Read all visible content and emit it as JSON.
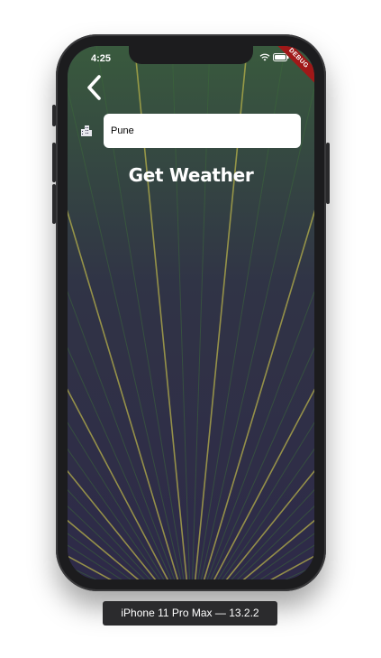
{
  "status_bar": {
    "time": "4:25",
    "wifi_icon": "wifi-icon",
    "battery_icon": "battery-icon"
  },
  "debug_banner": {
    "label": "DEBUG",
    "color": "#a01818"
  },
  "nav": {
    "back_icon": "chevron-left-icon"
  },
  "search": {
    "icon": "city-icon",
    "value": "Pune"
  },
  "action": {
    "label": "Get Weather"
  },
  "simulator": {
    "caption": "iPhone 11 Pro Max — 13.2.2"
  },
  "colors": {
    "background_dark": "#2e2a48",
    "leaf_green": "#3d6a3a",
    "leaf_yellow": "#b7b24a",
    "text": "#ffffff"
  }
}
